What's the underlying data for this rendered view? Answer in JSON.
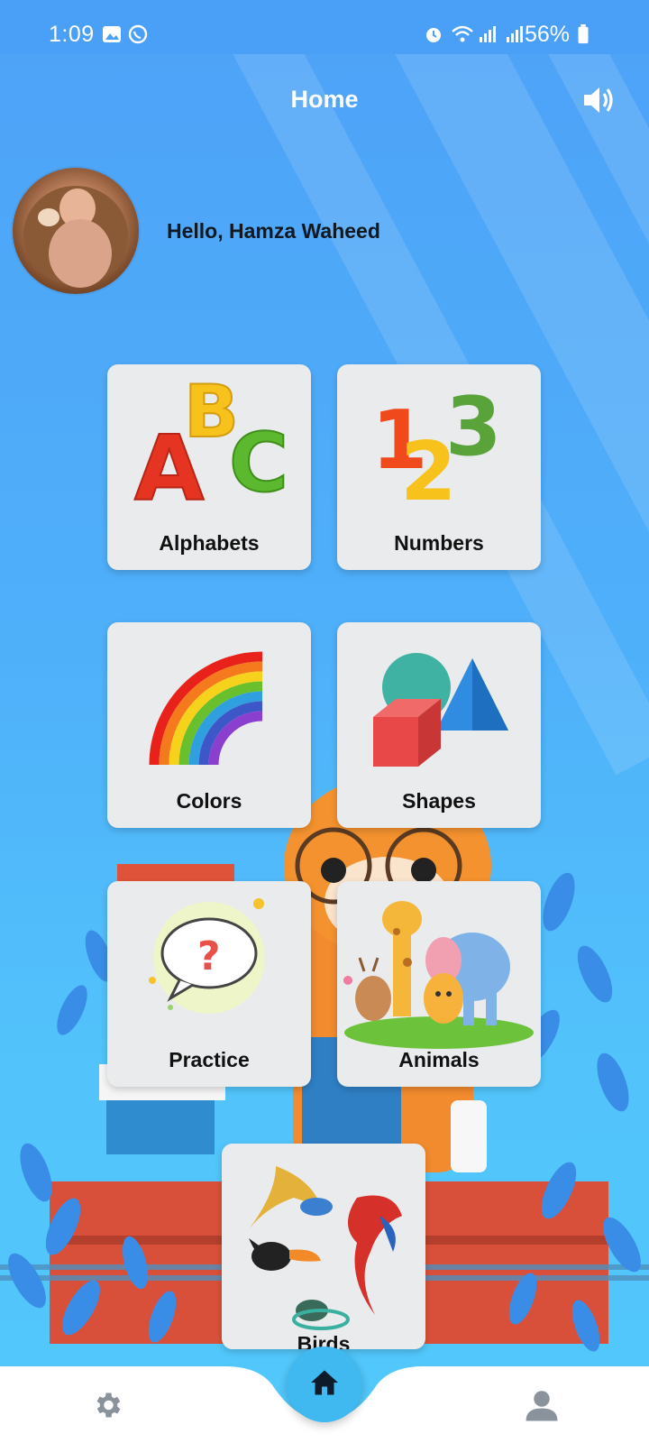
{
  "status_bar": {
    "time": "1:09",
    "battery": "56%",
    "icons": [
      "gallery-icon",
      "whatsapp-icon",
      "alarm-icon",
      "wifi-icon",
      "signal-icon",
      "signal-icon",
      "battery-icon"
    ]
  },
  "header": {
    "title": "Home",
    "sound_icon": "speaker-icon"
  },
  "profile": {
    "greeting": "Hello, Hamza Waheed"
  },
  "categories": [
    {
      "label": "Alphabets",
      "icon": "abc-letters-icon"
    },
    {
      "label": "Numbers",
      "icon": "123-numbers-icon"
    },
    {
      "label": "Colors",
      "icon": "rainbow-icon"
    },
    {
      "label": "Shapes",
      "icon": "shapes-icon"
    },
    {
      "label": "Practice",
      "icon": "question-bubble-icon"
    },
    {
      "label": "Animals",
      "icon": "animals-icon"
    },
    {
      "label": "Birds",
      "icon": "birds-icon"
    }
  ],
  "bottom_nav": {
    "left_icon": "gear-icon",
    "center_icon": "home-icon",
    "right_icon": "user-icon"
  },
  "colors": {
    "background": "#4ea2f7",
    "tile": "#e9ebed",
    "fab": "#3fb9ef"
  }
}
